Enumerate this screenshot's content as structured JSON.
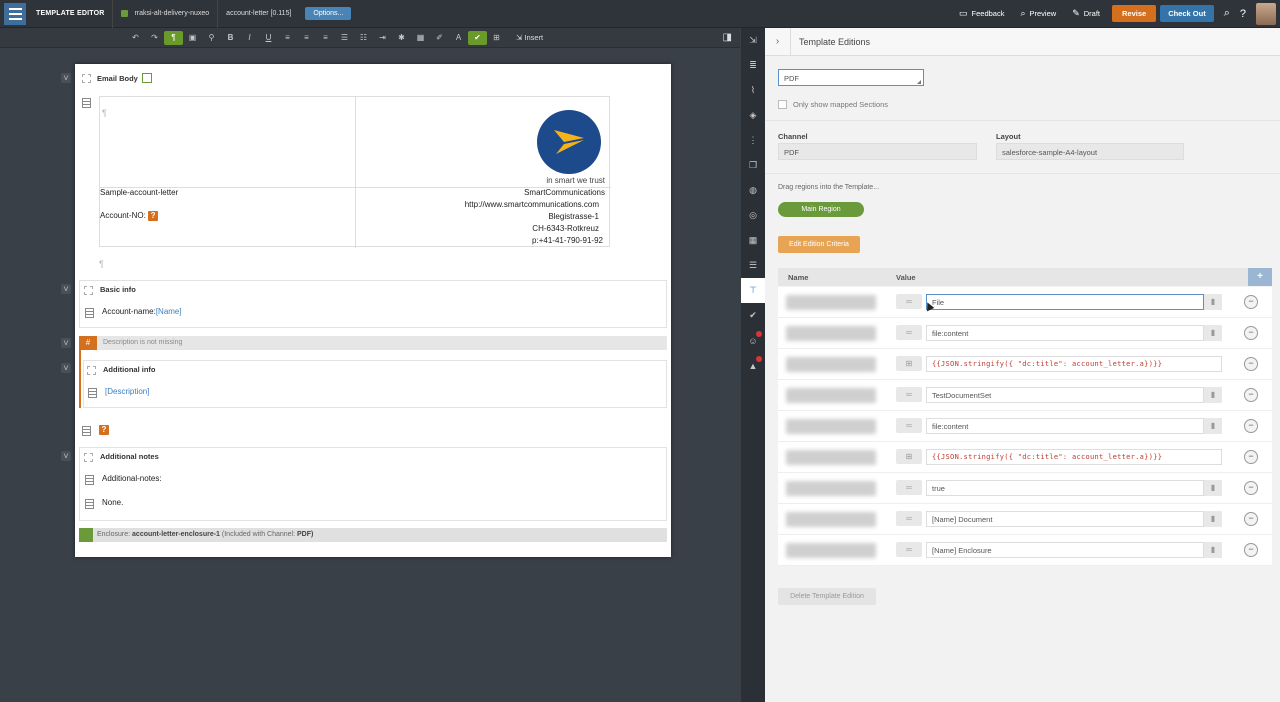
{
  "app": {
    "title": "TEMPLATE EDITOR",
    "crumb1": "rraksi-alt-delivery-nuxeo",
    "crumb2": "account-letter [0.115]",
    "options": "Options..."
  },
  "top": {
    "feedback": "Feedback",
    "preview": "Preview",
    "draft": "Draft",
    "revise": "Revise",
    "checkout": "Check Out"
  },
  "toolbar": {
    "insert": "Insert"
  },
  "doc": {
    "email_body": "Email Body",
    "sample": "Sample-account-letter",
    "account_no": "Account-NO:",
    "trust": "in smart we trust",
    "company": "SmartCommunications",
    "url": "http://www.smartcommunications.com",
    "street": "Blegistrasse-1",
    "city": "CH-6343-Rotkreuz",
    "phone": "p:+41-41-790-91-92",
    "basic_info": "Basic info",
    "account_name": "Account-name:",
    "name_field": "[Name]",
    "condition": "Description is not missing",
    "additional_info": "Additional info",
    "description_field": "[Description]",
    "additional_notes": "Additional notes",
    "notes_label": "Additional-notes:",
    "none": "None.",
    "enclosure_prefix": "Enclosure:",
    "enclosure_name": "account-letter-enclosure-1",
    "enclosure_suffix": "(Included with Channel:",
    "enclosure_channel": "PDF)"
  },
  "panel": {
    "title": "Template Editions",
    "edition": "PDF",
    "only_mapped": "Only show mapped Sections",
    "channel_label": "Channel",
    "channel": "PDF",
    "layout_label": "Layout",
    "layout": "salesforce-sample-A4-layout",
    "drag": "Drag regions into the Template...",
    "region": "Main Region",
    "edit_criteria": "Edit Edition Criteria",
    "col_name": "Name",
    "col_value": "Value",
    "rows": [
      {
        "value": "File",
        "code": false
      },
      {
        "value": "file:content",
        "code": false
      },
      {
        "value": "{{JSON.stringify({ \"dc:title\": account_letter.a})}}",
        "code": true
      },
      {
        "value": "TestDocumentSet",
        "code": false
      },
      {
        "value": "file:content",
        "code": false
      },
      {
        "value": "{{JSON.stringify({ \"dc:title\": account_letter.a})}}",
        "code": true
      },
      {
        "value": "true",
        "code": false
      },
      {
        "value": "[Name] Document",
        "code": false
      },
      {
        "value": "[Name] Enclosure",
        "code": false
      }
    ],
    "delete": "Delete Template Edition"
  },
  "colors": {
    "accent": "#3574a8",
    "orange": "#d46f1e",
    "green": "#6b9a3a"
  }
}
